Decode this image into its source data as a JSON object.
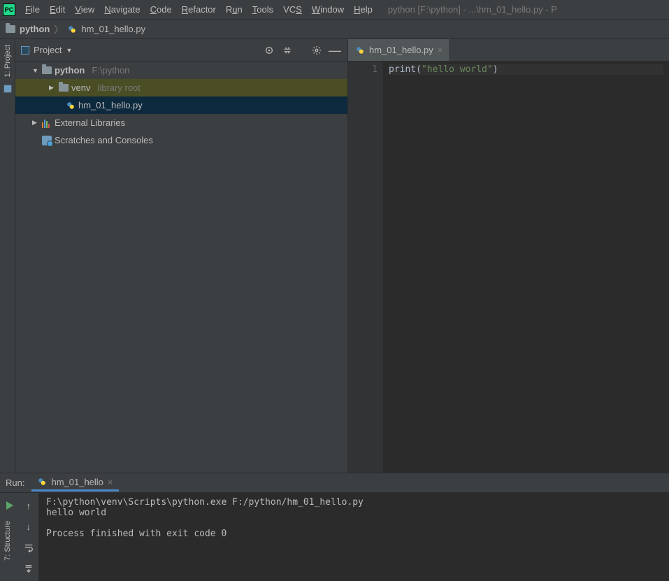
{
  "menu": {
    "items": [
      "File",
      "Edit",
      "View",
      "Navigate",
      "Code",
      "Refactor",
      "Run",
      "Tools",
      "VCS",
      "Window",
      "Help"
    ],
    "underlines": [
      "F",
      "E",
      "V",
      "N",
      "C",
      "R",
      "u",
      "T",
      "S",
      "W",
      "H"
    ]
  },
  "title_path": "python [F:\\python] - ...\\hm_01_hello.py - P",
  "breadcrumb": {
    "root": "python",
    "file": "hm_01_hello.py"
  },
  "project": {
    "panel_title": "Project",
    "root": {
      "name": "python",
      "hint": "F:\\python"
    },
    "venv": {
      "name": "venv",
      "hint": "library root"
    },
    "file": "hm_01_hello.py",
    "external": "External Libraries",
    "scratches": "Scratches and Consoles"
  },
  "sidebars": {
    "project": "1: Project",
    "structure": "7: Structure"
  },
  "editor": {
    "tab": "hm_01_hello.py",
    "line_numbers": [
      "1"
    ],
    "code": {
      "fn": "print",
      "open": "(",
      "str": "\"hello world\"",
      "close": ")"
    }
  },
  "run": {
    "label": "Run:",
    "tab": "hm_01_hello",
    "output": "F:\\python\\venv\\Scripts\\python.exe F:/python/hm_01_hello.py\nhello world\n\nProcess finished with exit code 0"
  }
}
